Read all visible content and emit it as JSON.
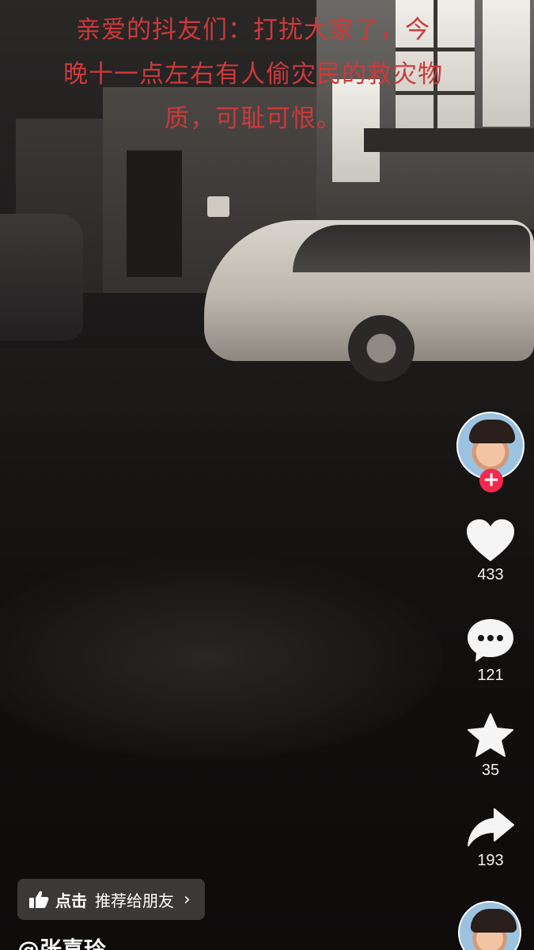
{
  "overlay": {
    "line1": "亲爱的抖友们：打扰大家了，今",
    "line2": "晚十一点左右有人偷灾民的救灾物",
    "line3": "质，可耻可恨。"
  },
  "actions": {
    "follow_label": "+",
    "likes": "433",
    "comments": "121",
    "favorites": "35",
    "shares": "193"
  },
  "recommend": {
    "tap": "点击",
    "text": "推荐给朋友",
    "chevron": "›"
  },
  "author": {
    "handle": "@张喜玲"
  },
  "colors": {
    "caption": "#cc3a3a",
    "follow": "#f3294e"
  }
}
